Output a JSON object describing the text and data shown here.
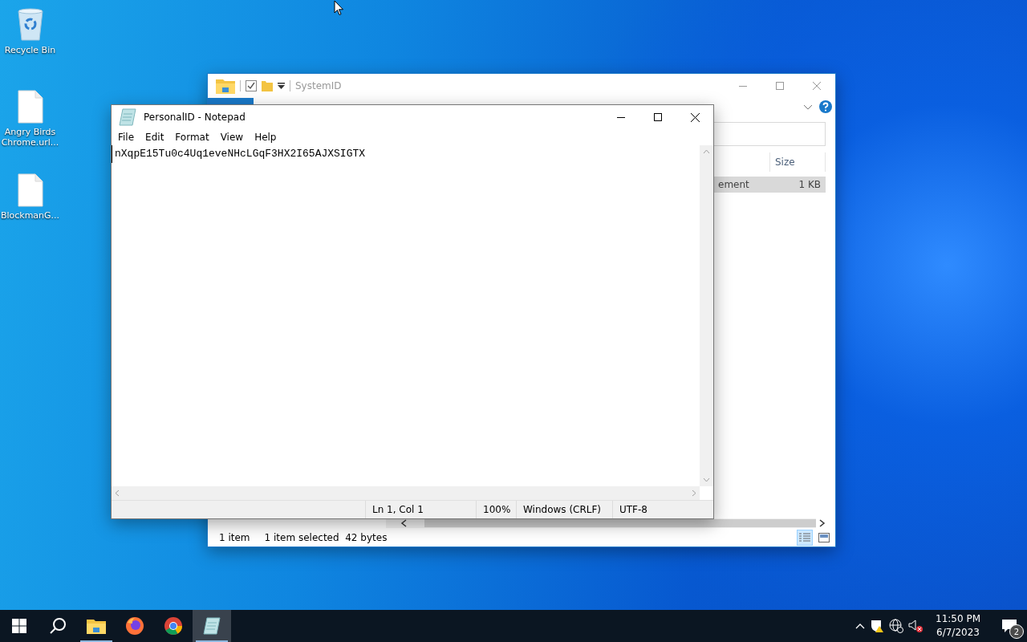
{
  "desktop_icons": [
    {
      "label": "Recycle Bin",
      "kind": "bin"
    },
    {
      "label": "Angry Birds Chrome.url...",
      "kind": "file"
    },
    {
      "label": "BlockmanG...",
      "kind": "file"
    }
  ],
  "explorer": {
    "title": "SystemID",
    "columns": [
      "Size"
    ],
    "rows": [
      {
        "name": "ement",
        "size": "1 KB",
        "selected": true
      }
    ],
    "status": {
      "items": "1 item",
      "selection": "1 item selected",
      "size": "42 bytes"
    }
  },
  "notepad": {
    "title": "PersonalID - Notepad",
    "menu": [
      "File",
      "Edit",
      "Format",
      "View",
      "Help"
    ],
    "content": "nXqpE15Tu0c4Uq1eveNHcLGqF3HX2I65AJXSIGTX",
    "status": [
      "Ln 1, Col 1",
      "100%",
      "Windows (CRLF)",
      "UTF-8"
    ]
  },
  "taskbar": {
    "apps": [
      {
        "kind": "explorer",
        "running": true,
        "selected": false
      },
      {
        "kind": "firefox",
        "running": false,
        "selected": false
      },
      {
        "kind": "chrome",
        "running": false,
        "selected": false
      },
      {
        "kind": "notepad",
        "running": true,
        "selected": true
      }
    ],
    "time": "11:50 PM",
    "date": "6/7/2023",
    "notifications": "2"
  }
}
